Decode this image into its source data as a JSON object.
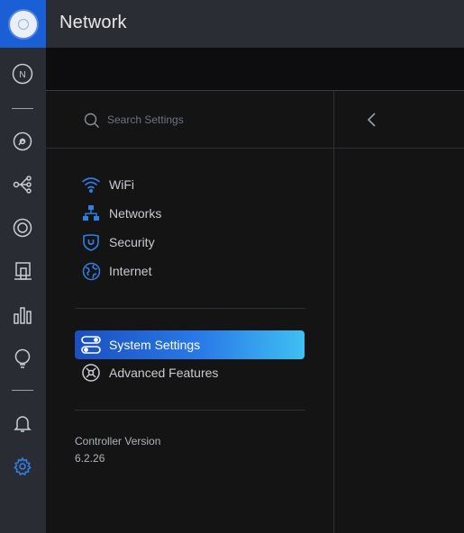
{
  "app": {
    "title": "Network",
    "accent": "#1b5fd6"
  },
  "rail": {
    "items": [
      {
        "name": "dashboard-icon",
        "glyph": "N"
      },
      {
        "name": "statistics-icon"
      },
      {
        "name": "topology-icon"
      },
      {
        "name": "devices-icon"
      },
      {
        "name": "clients-icon"
      },
      {
        "name": "insights-icon"
      },
      {
        "name": "events-icon"
      },
      {
        "name": "alerts-icon"
      },
      {
        "name": "settings-icon",
        "active": true
      }
    ]
  },
  "settings": {
    "search_placeholder": "Search Settings",
    "groups": [
      [
        {
          "label": "WiFi",
          "icon": "wifi-icon"
        },
        {
          "label": "Networks",
          "icon": "networks-icon"
        },
        {
          "label": "Security",
          "icon": "security-icon"
        },
        {
          "label": "Internet",
          "icon": "internet-icon"
        }
      ],
      [
        {
          "label": "System Settings",
          "icon": "system-settings-icon",
          "active": true
        },
        {
          "label": "Advanced Features",
          "icon": "advanced-features-icon"
        }
      ]
    ],
    "controller_version_label": "Controller Version",
    "controller_version_value": "6.2.26"
  },
  "colors": {
    "icon_blue": "#2f7fe6",
    "active_gradient_start": "#1a4fc0",
    "active_gradient_end": "#3ec0f2"
  }
}
